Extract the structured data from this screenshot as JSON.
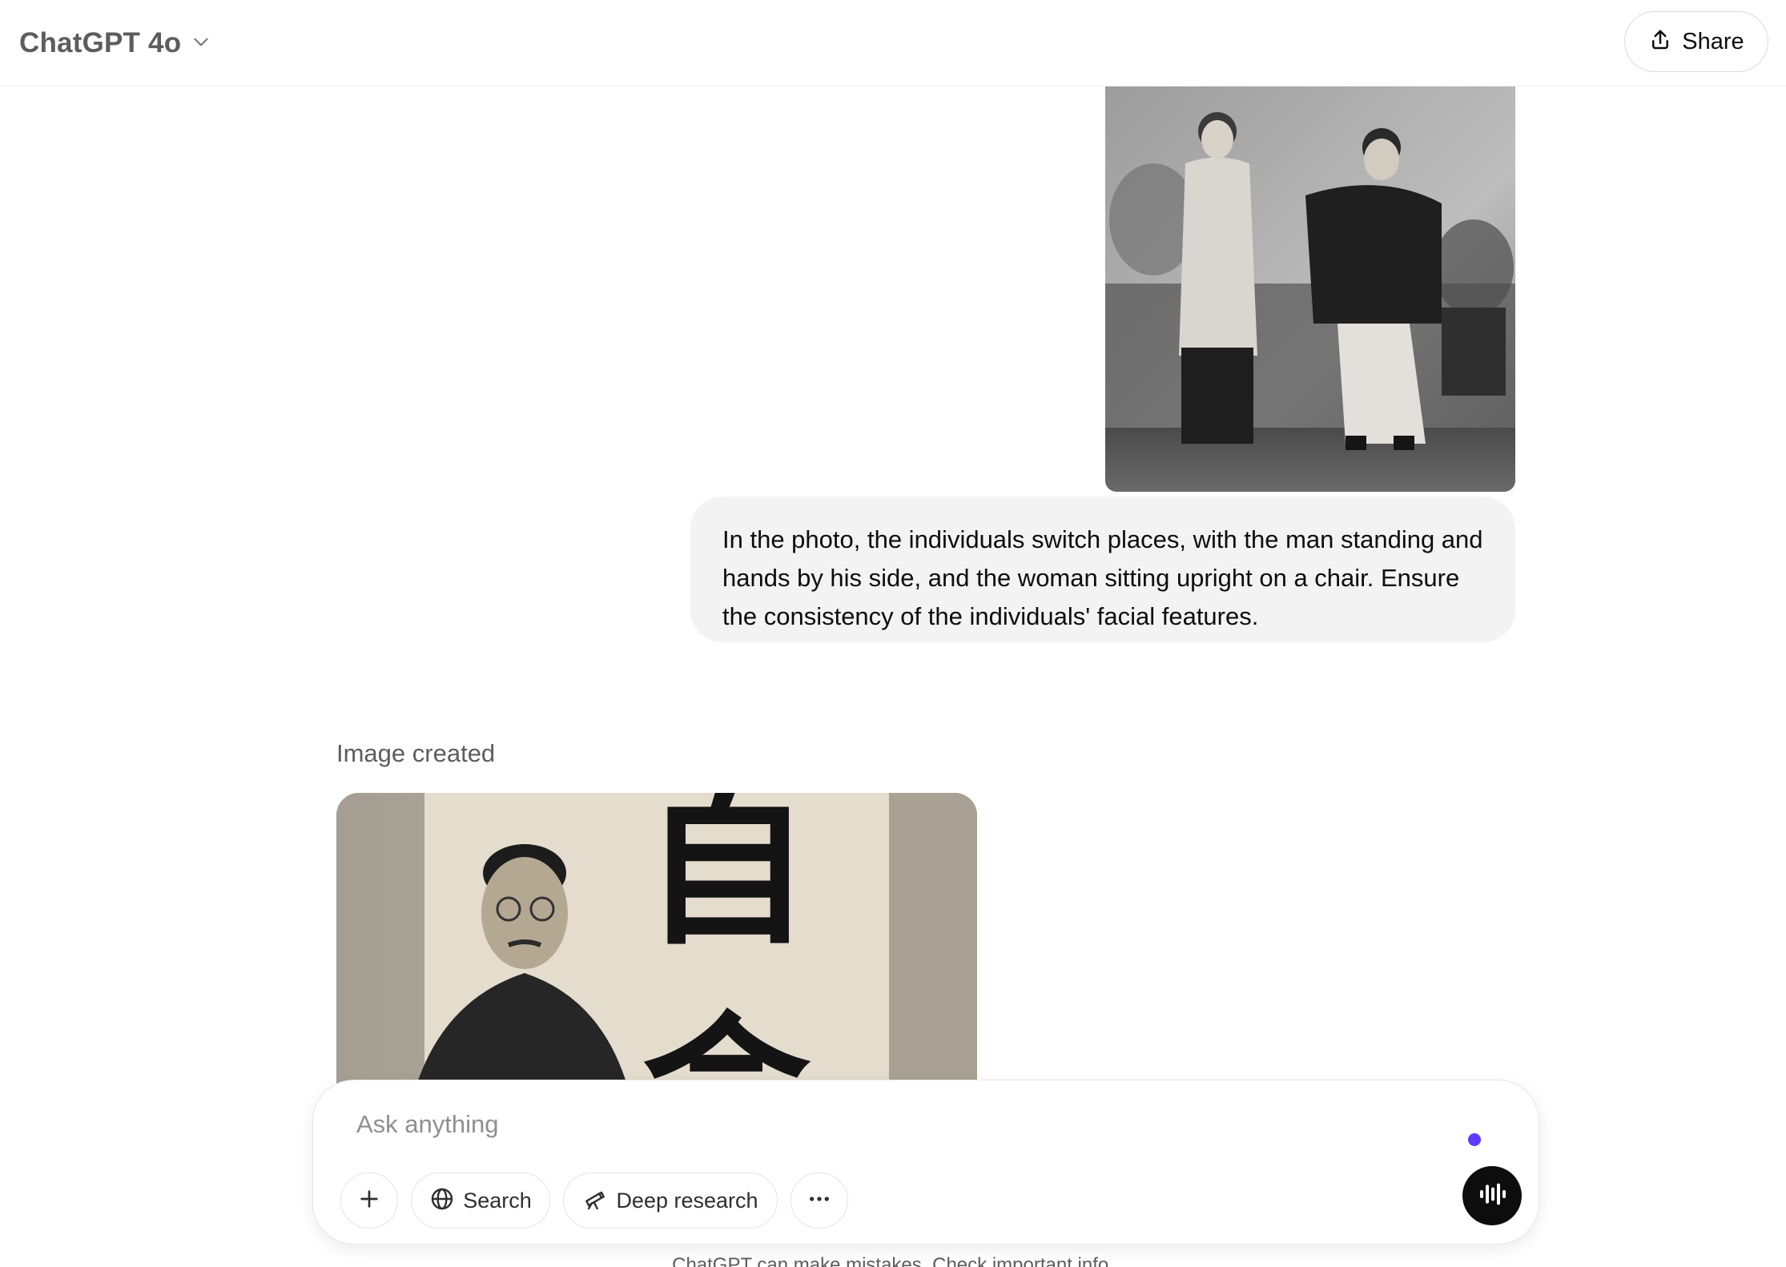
{
  "header": {
    "model_name": "ChatGPT 4o",
    "share_label": "Share"
  },
  "conversation": {
    "user_message": "In the photo, the individuals switch places, with the man standing and hands by his side, and the woman sitting upright on a chair. Ensure the consistency of the individuals' facial features.",
    "assistant_status": "Image created",
    "generated_image_characters": "自 命"
  },
  "composer": {
    "placeholder": "Ask anything",
    "tools": {
      "search_label": "Search",
      "deep_research_label": "Deep research"
    }
  },
  "footer": {
    "note": "ChatGPT can make mistakes. Check important info."
  },
  "icons": {
    "model_dropdown": "chevron-down-icon",
    "share": "upload-icon",
    "download": "arrow-down-icon",
    "add": "plus-icon",
    "search": "globe-icon",
    "deep_research": "telescope-icon",
    "more": "ellipsis-icon",
    "voice": "voice-waveform-icon"
  },
  "colors": {
    "text_primary": "#0d0d0d",
    "text_secondary": "#5d5d5d",
    "bubble_bg": "#f3f3f3",
    "typing_dot": "#5b3cff",
    "voice_button_bg": "#0d0d0d"
  }
}
